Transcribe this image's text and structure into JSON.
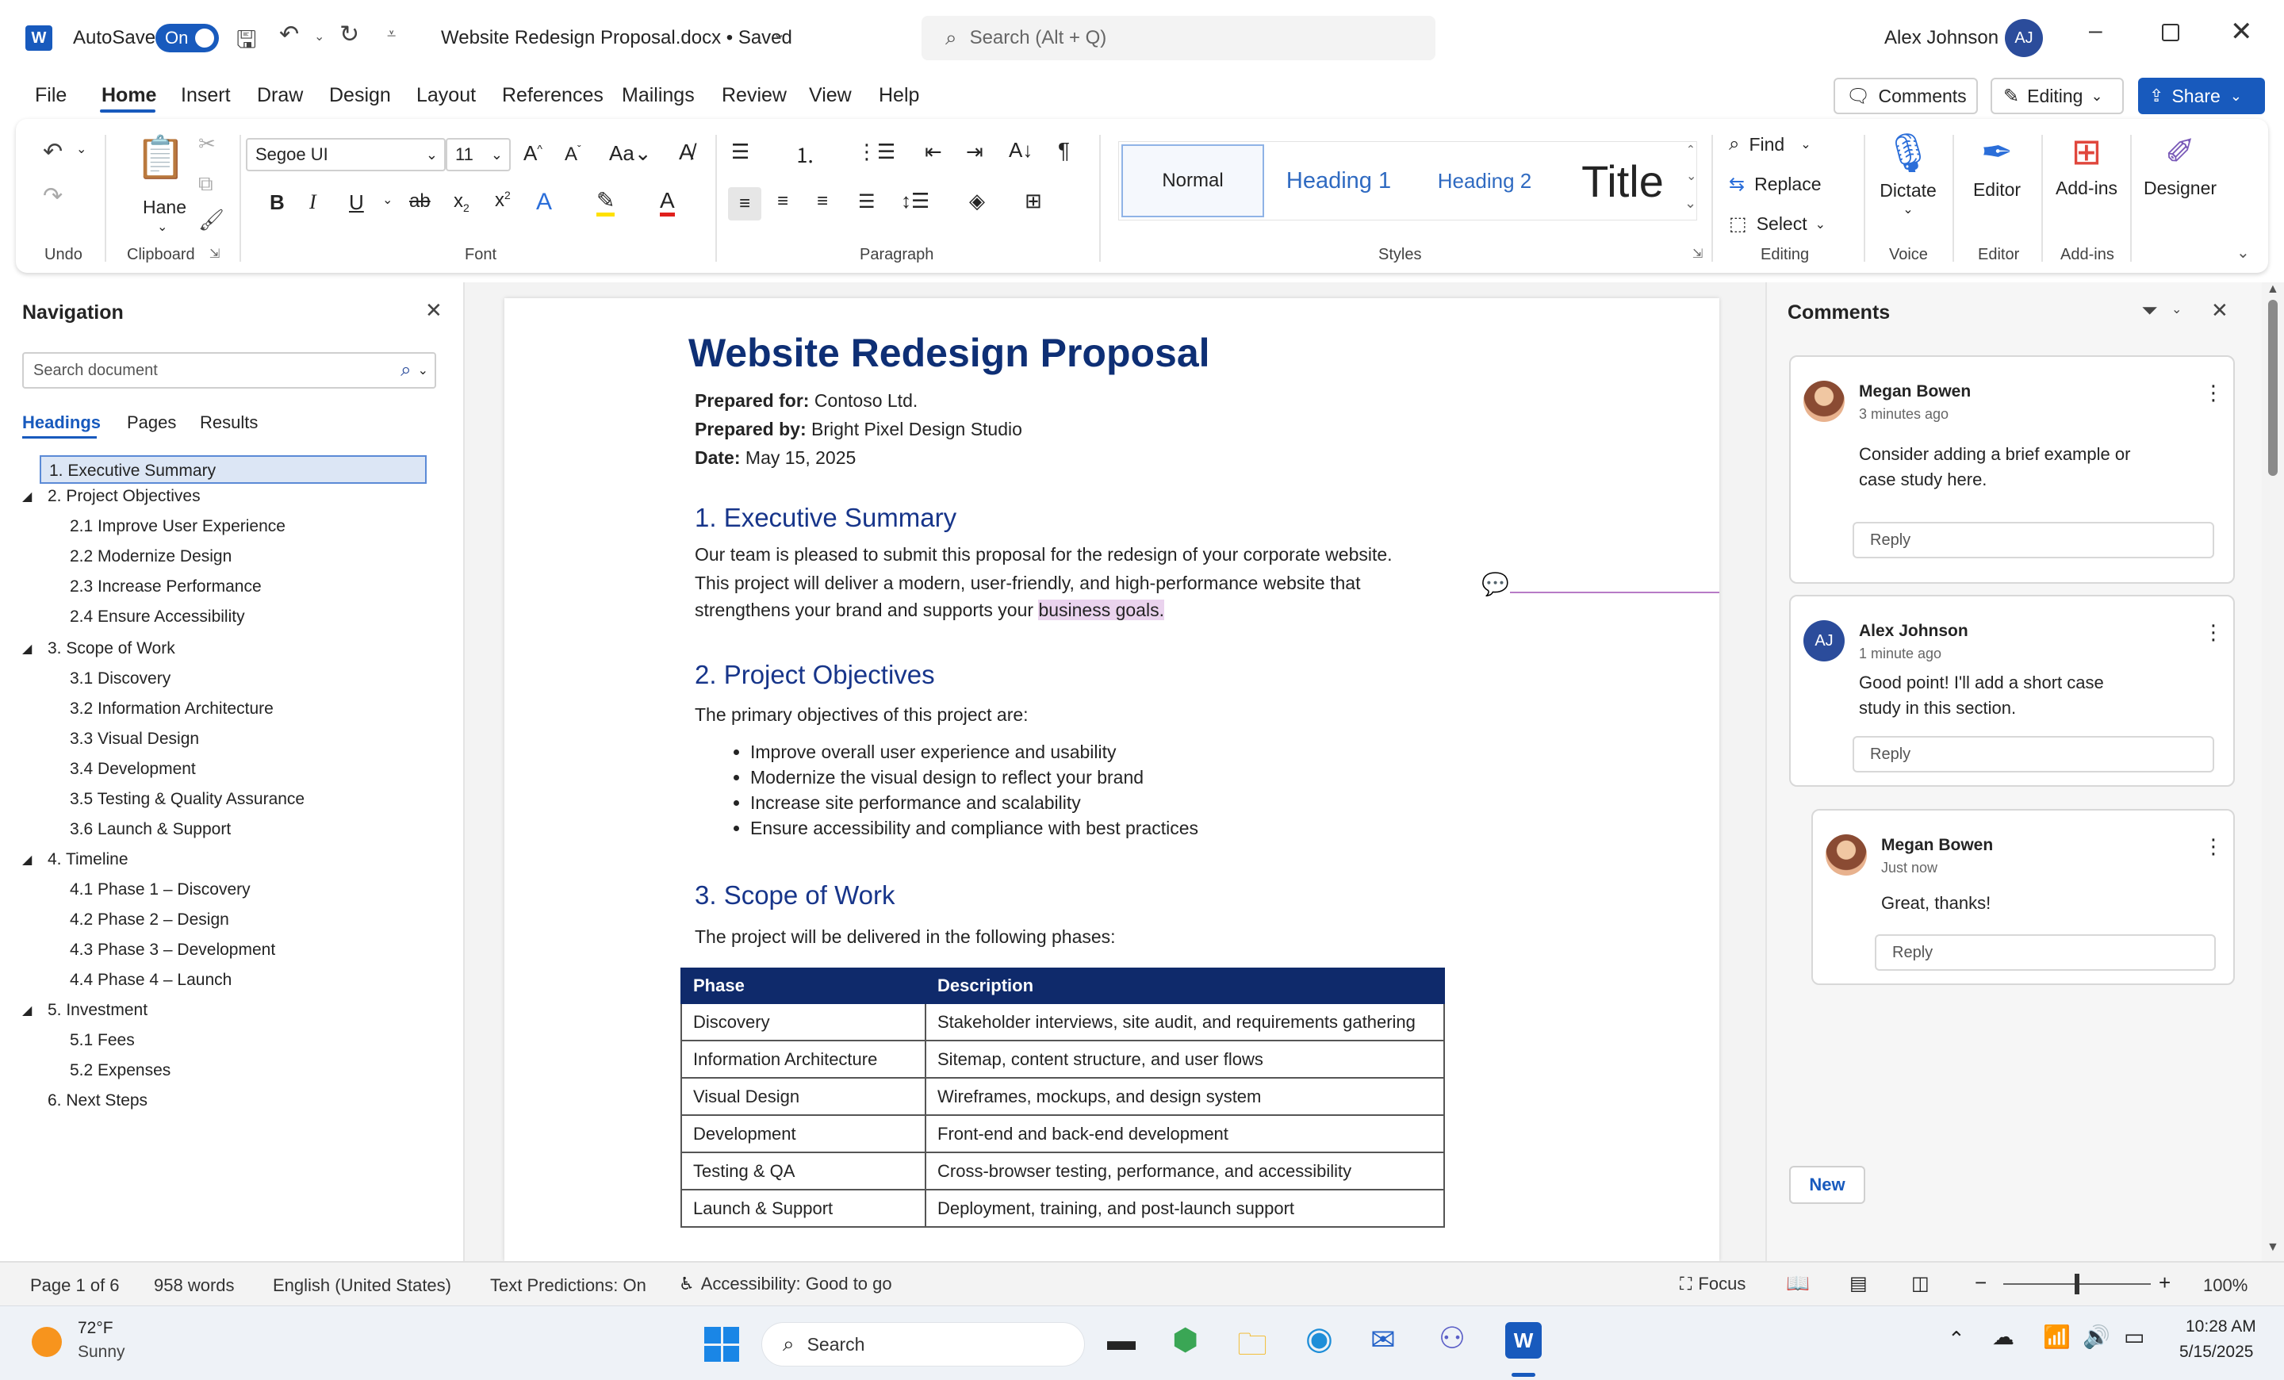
{
  "titlebar": {
    "app_icon": "word-icon",
    "autosave_label": "AutoSave",
    "autosave_state": "On",
    "doc_title": "Website Redesign Proposal.docx • Saved",
    "search_placeholder": "Search (Alt + Q)",
    "user_name": "Alex Johnson",
    "user_initials": "AJ"
  },
  "menu_tabs": [
    "File",
    "Home",
    "Insert",
    "Draw",
    "Design",
    "Layout",
    "References",
    "Mailings",
    "Review",
    "View",
    "Help"
  ],
  "active_tab": "Home",
  "top_right": {
    "comments": "Comments",
    "editing": "Editing",
    "share": "Share"
  },
  "ribbon": {
    "undo_group": "Undo",
    "clipboard_group": "Clipboard",
    "paste_label": "Hane",
    "font_group": "Font",
    "font_name": "Segoe UI",
    "font_size": "11",
    "paragraph_group": "Paragraph",
    "styles_group": "Styles",
    "styles": [
      "Normal",
      "Heading 1",
      "Heading 2",
      "Title"
    ],
    "editing_group": "Editing",
    "find": "Find",
    "replace": "Replace",
    "select": "Select",
    "voice_group": "Voice",
    "dictate": "Dictate",
    "editor_group": "Editor",
    "editor": "Editor",
    "addins_group": "Add-ins",
    "addins": "Add-ins",
    "designer": "Designer",
    "accent": "#185abd"
  },
  "nav": {
    "title": "Navigation",
    "search_placeholder": "Search document",
    "tabs": [
      "Headings",
      "Pages",
      "Results"
    ],
    "items": [
      {
        "text": "1. Executive Summary",
        "level": 1,
        "selected": true
      },
      {
        "text": "2. Project Objectives",
        "level": 1,
        "expanded": true
      },
      {
        "text": "2.1 Improve User Experience",
        "level": 2
      },
      {
        "text": "2.2 Modernize Design",
        "level": 2
      },
      {
        "text": "2.3 Increase Performance",
        "level": 2
      },
      {
        "text": "2.4 Ensure Accessibility",
        "level": 2
      },
      {
        "text": "3. Scope of Work",
        "level": 1,
        "expanded": true
      },
      {
        "text": "3.1 Discovery",
        "level": 2
      },
      {
        "text": "3.2 Information Architecture",
        "level": 2
      },
      {
        "text": "3.3 Visual Design",
        "level": 2
      },
      {
        "text": "3.4 Development",
        "level": 2
      },
      {
        "text": "3.5 Testing & Quality Assurance",
        "level": 2
      },
      {
        "text": "3.6 Launch & Support",
        "level": 2
      },
      {
        "text": "4. Timeline",
        "level": 1,
        "expanded": true
      },
      {
        "text": "4.1 Phase 1 – Discovery",
        "level": 2
      },
      {
        "text": "4.2 Phase 2 – Design",
        "level": 2
      },
      {
        "text": "4.3 Phase 3 – Development",
        "level": 2
      },
      {
        "text": "4.4 Phase 4 – Launch",
        "level": 2
      },
      {
        "text": "5. Investment",
        "level": 1,
        "expanded": true
      },
      {
        "text": "5.1 Fees",
        "level": 2
      },
      {
        "text": "5.2 Expenses",
        "level": 2
      },
      {
        "text": "6. Next Steps",
        "level": 1
      }
    ]
  },
  "doc": {
    "title": "Website Redesign Proposal",
    "prepared_for_label": "Prepared for:",
    "prepared_for": "Contoso Ltd.",
    "prepared_by_label": "Prepared by:",
    "prepared_by": "Bright Pixel Design Studio",
    "date_label": "Date:",
    "date": "May 15, 2025",
    "h_exec": "1. Executive Summary",
    "exec_line1": "Our team is pleased to submit this proposal for the redesign of your corporate website.",
    "exec_line2": "This project will deliver a modern, user-friendly, and high-performance website that",
    "exec_line3_pre": "strengthens your brand and supports your",
    "exec_highlight": "business goals.",
    "h_obj": "2. Project Objectives",
    "obj_intro": "The primary objectives of this project are:",
    "bullets": [
      "Improve overall user experience and usability",
      "Modernize the visual design to reflect your brand",
      "Increase site performance and scalability",
      "Ensure accessibility and compliance with best practices"
    ],
    "h_scope": "3. Scope of Work",
    "scope_intro": "The project will be delivered in the following phases:",
    "table_headers": [
      "Phase",
      "Description"
    ],
    "table_rows": [
      [
        "Discovery",
        "Stakeholder interviews, site audit, and requirements gathering"
      ],
      [
        "Information Architecture",
        "Sitemap, content structure, and user flows"
      ],
      [
        "Visual Design",
        "Wireframes, mockups, and design system"
      ],
      [
        "Development",
        "Front-end and back-end development"
      ],
      [
        "Testing & QA",
        "Cross-browser testing, performance, and accessibility"
      ],
      [
        "Launch & Support",
        "Deployment, training, and post-launch support"
      ]
    ],
    "table_header_color": "#0f2a6b"
  },
  "comments": {
    "title": "Comments",
    "new_button": "New",
    "threads": [
      {
        "author": "Megan Bowen",
        "time": "3 minutes ago",
        "text_line1": "Consider adding a brief example or",
        "text_line2": "case study here.",
        "reply": "Reply"
      },
      {
        "author": "Alex Johnson",
        "initials": "AJ",
        "time": "1 minute ago",
        "text_line1": "Good point! I'll add a short case",
        "text_line2": "study in this section.",
        "reply": "Reply"
      },
      {
        "author": "Megan Bowen",
        "time": "Just now",
        "text_line1": "Great, thanks!",
        "reply": "Reply"
      }
    ]
  },
  "status": {
    "page": "Page 1 of 6",
    "words": "958 words",
    "language": "English (United States)",
    "predictions": "Text Predictions: On",
    "accessibility": "Accessibility: Good to go",
    "focus": "Focus",
    "zoom": "100%",
    "zoom_level": 0.5
  },
  "taskbar": {
    "temp": "72°F",
    "weather": "Sunny",
    "search": "Search",
    "time": "10:28 AM",
    "date": "5/15/2025"
  }
}
